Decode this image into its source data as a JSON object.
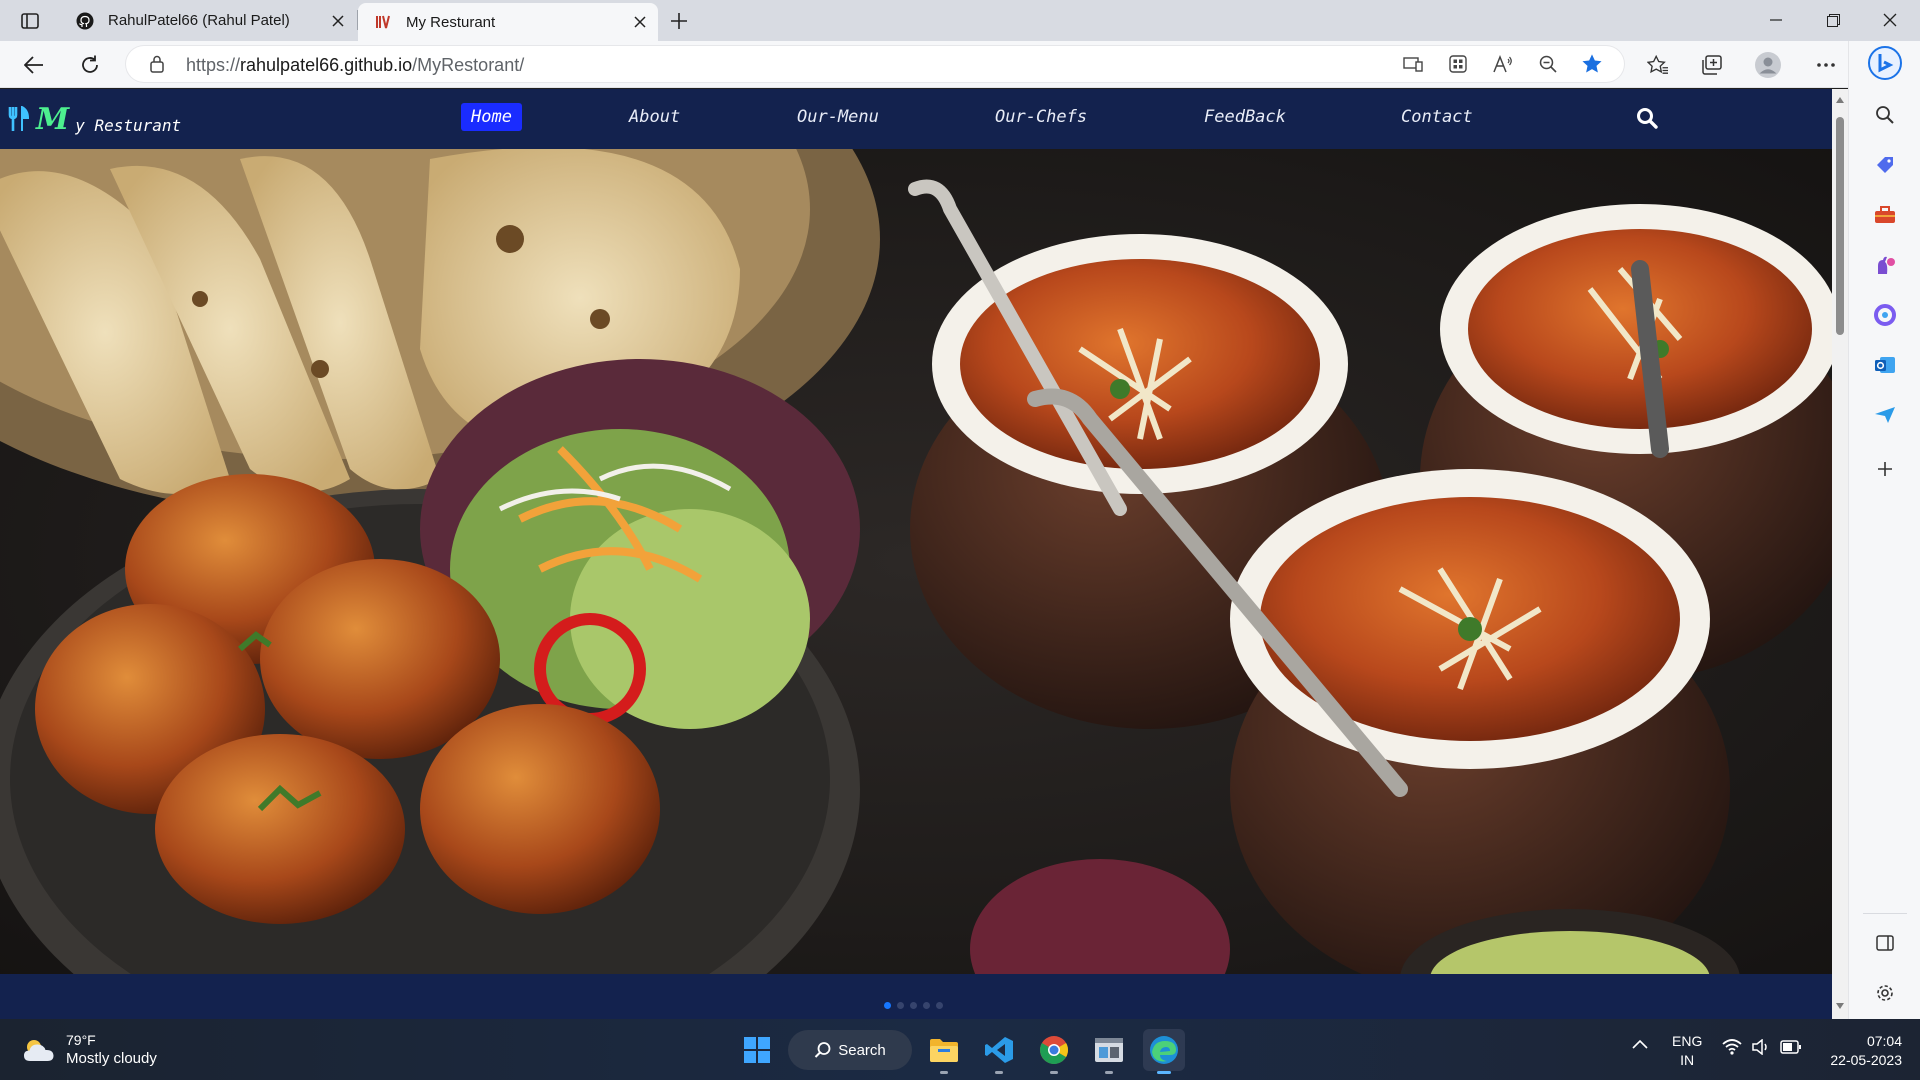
{
  "browser": {
    "tabs": [
      {
        "title": "RahulPatel66 (Rahul Patel)",
        "favicon": "github-icon",
        "active": false
      },
      {
        "title": "My Resturant",
        "favicon": "restaurant-logo-icon",
        "active": true
      }
    ],
    "url": {
      "protocol": "https://",
      "host": "rahulpatel66.github.io",
      "path": "/MyRestorant/"
    },
    "window_controls": [
      "minimize",
      "restore",
      "close"
    ]
  },
  "site": {
    "brand": {
      "logo_icon": "fork-knife-icon",
      "initial": "M",
      "name": "y Resturant"
    },
    "nav": [
      {
        "label": "Home",
        "active": true
      },
      {
        "label": "About"
      },
      {
        "label": "Our-Menu"
      },
      {
        "label": "Our-Chefs"
      },
      {
        "label": "FeedBack"
      },
      {
        "label": "Contact"
      }
    ],
    "hero_alt": "Indian food: naan basket, pakoras with salad, curry bowls",
    "carousel": {
      "slides": 5,
      "active": 1
    }
  },
  "taskbar": {
    "weather": {
      "temp": "79°F",
      "condition": "Mostly cloudy"
    },
    "search_label": "Search",
    "language": {
      "line1": "ENG",
      "line2": "IN"
    },
    "clock": {
      "time": "07:04",
      "date": "22-05-2023"
    }
  },
  "colors": {
    "navbar": "#13224e",
    "active_nav": "#1a2cff",
    "brand_green": "#4df08f"
  }
}
